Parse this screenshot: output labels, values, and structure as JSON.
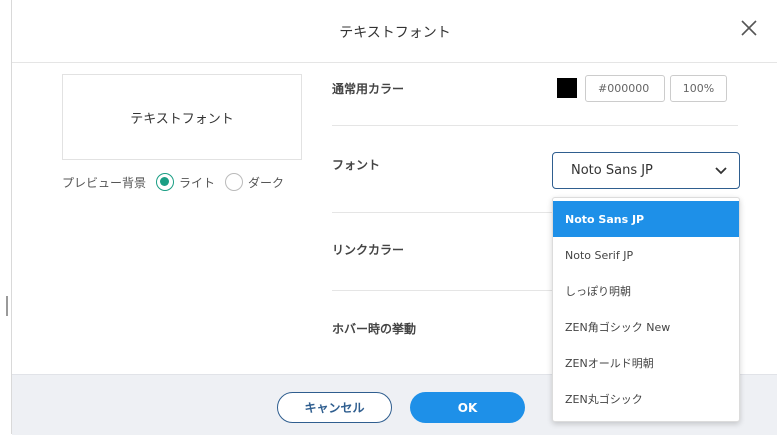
{
  "dialog": {
    "title": "テキストフォント"
  },
  "preview": {
    "sample_text": "テキストフォント",
    "background_label": "プレビュー背景",
    "options": [
      "ライト",
      "ダーク"
    ],
    "selected": "ライト"
  },
  "settings": {
    "normal_color_label": "通常用カラー",
    "normal_color_hex": "#000000",
    "normal_color_opacity": "100%",
    "font_label": "フォント",
    "font_selected": "Noto Sans JP",
    "link_color_label": "リンクカラー",
    "hover_label": "ホバー時の挙動"
  },
  "font_options": [
    "Noto Sans JP",
    "Noto Serif JP",
    "しっぽり明朝",
    "ZEN角ゴシック New",
    "ZENオールド明朝",
    "ZEN丸ゴシック"
  ],
  "footer": {
    "cancel_label": "キャンセル",
    "ok_label": "OK"
  },
  "colors": {
    "accent_blue": "#1e90e8",
    "border_blue": "#2f5e8f",
    "radio_green": "#1a9e84",
    "swatch": "#000000"
  },
  "icons": {
    "close": "close-icon",
    "chevron": "chevron-down-icon"
  }
}
